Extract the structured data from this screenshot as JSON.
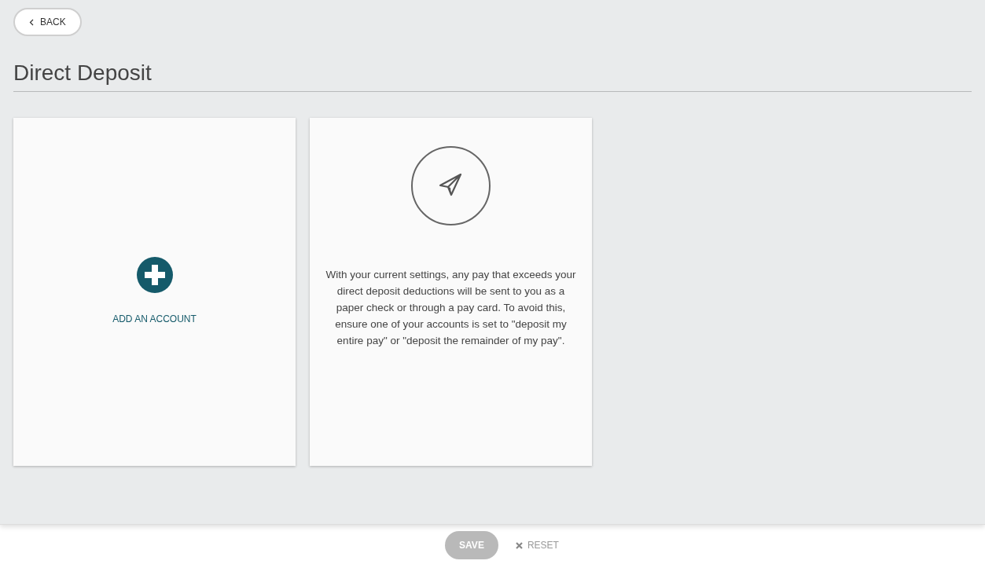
{
  "back_button": {
    "label": "BACK"
  },
  "page_title": "Direct Deposit",
  "add_account": {
    "label": "ADD AN ACCOUNT"
  },
  "notice": {
    "text": "With your current settings, any pay that exceeds your direct deposit deductions will be sent to you as a paper check or through a pay card. To avoid this, ensure one of your accounts is set to \"deposit my entire pay\" or \"deposit the remainder of my pay\"."
  },
  "footer": {
    "save": {
      "label": "SAVE",
      "disabled": true
    },
    "reset": {
      "label": "RESET",
      "disabled": false
    }
  }
}
